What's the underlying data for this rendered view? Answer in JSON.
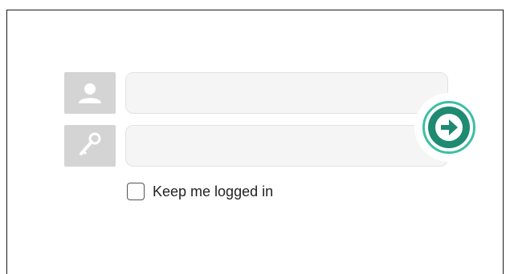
{
  "login": {
    "username": {
      "value": "",
      "placeholder": ""
    },
    "password": {
      "value": "",
      "placeholder": ""
    },
    "submit_icon": "arrow-right-icon",
    "remember_me": {
      "label": "Keep me logged in",
      "checked": false
    }
  },
  "icons": {
    "username": "user-icon",
    "password": "key-icon"
  },
  "colors": {
    "icon_box": "#d4d4d4",
    "field_bg": "#f5f5f5",
    "submit_ring": "#3dbfa5",
    "submit_fill": "#1f8a72"
  }
}
